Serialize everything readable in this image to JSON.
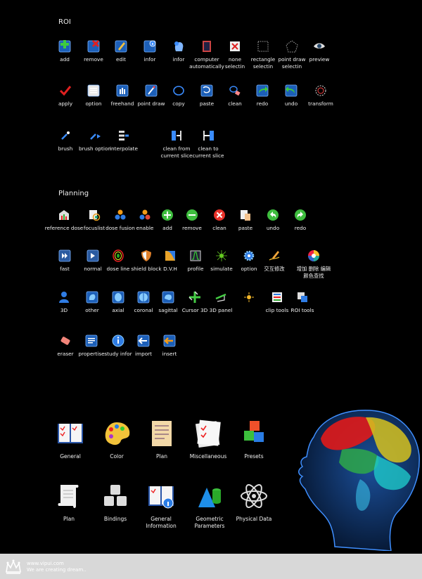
{
  "roi": {
    "title": "ROI",
    "row1": [
      {
        "label": "add",
        "icon": "add-roi-icon"
      },
      {
        "label": "remove",
        "icon": "remove-roi-icon"
      },
      {
        "label": "edit",
        "icon": "edit-roi-icon"
      },
      {
        "label": "infor",
        "icon": "info-roi-icon"
      },
      {
        "label": "infor",
        "icon": "head-info-icon"
      },
      {
        "label": "computer\nautomatically",
        "icon": "computer-auto-icon"
      },
      {
        "label": "none\nselectin",
        "icon": "none-selection-icon"
      },
      {
        "label": "rectangle\nselectin",
        "icon": "rectangle-selection-icon"
      },
      {
        "label": "point draw\nselectin",
        "icon": "point-draw-selection-icon"
      },
      {
        "label": "preview",
        "icon": "eye-preview-icon"
      }
    ],
    "row2": [
      {
        "label": "apply",
        "icon": "checkmark-icon"
      },
      {
        "label": "option",
        "icon": "option-list-icon"
      },
      {
        "label": "freehand",
        "icon": "freehand-icon"
      },
      {
        "label": "point draw",
        "icon": "point-draw-icon"
      },
      {
        "label": "copy",
        "icon": "copy-icon"
      },
      {
        "label": "paste",
        "icon": "paste-icon"
      },
      {
        "label": "clean",
        "icon": "clean-icon"
      },
      {
        "label": "redo",
        "icon": "redo-icon"
      },
      {
        "label": "undo",
        "icon": "undo-icon"
      },
      {
        "label": "transform",
        "icon": "transform-icon"
      }
    ],
    "row3": [
      {
        "label": "brush",
        "icon": "brush-icon"
      },
      {
        "label": "brush option",
        "icon": "brush-option-icon"
      },
      {
        "label": "interpolate",
        "icon": "interpolate-icon"
      },
      {
        "label": "clean from\ncurrent slice",
        "icon": "clean-from-slice-icon"
      },
      {
        "label": "clean to\ncurrent slice",
        "icon": "clean-to-slice-icon"
      }
    ]
  },
  "planning": {
    "title": "Planning",
    "row1": [
      {
        "label": "reference dose",
        "icon": "reference-dose-icon"
      },
      {
        "label": "focuslist",
        "icon": "focuslist-icon"
      },
      {
        "label": "dose fusion",
        "icon": "dose-fusion-icon"
      },
      {
        "label": "enable",
        "icon": "enable-icon"
      },
      {
        "label": "add",
        "icon": "add-circle-icon"
      },
      {
        "label": "remove",
        "icon": "remove-circle-icon"
      },
      {
        "label": "clean",
        "icon": "clean-circle-icon"
      },
      {
        "label": "paste",
        "icon": "paste-doc-icon"
      },
      {
        "label": "undo",
        "icon": "undo-circle-icon"
      },
      {
        "label": "redo",
        "icon": "redo-circle-icon"
      }
    ],
    "row2": [
      {
        "label": "fast",
        "icon": "fast-icon"
      },
      {
        "label": "normal",
        "icon": "normal-icon"
      },
      {
        "label": "dose line",
        "icon": "dose-line-icon"
      },
      {
        "label": "shield block",
        "icon": "shield-block-icon"
      },
      {
        "label": "D.V.H",
        "icon": "dvh-icon"
      },
      {
        "label": "profile",
        "icon": "profile-icon"
      },
      {
        "label": "simulate",
        "icon": "simulate-icon"
      },
      {
        "label": "option",
        "icon": "gear-option-icon"
      },
      {
        "label": "交互修改",
        "icon": "interactive-edit-icon"
      },
      {
        "label": "增加 删除 编辑\n颜色查找",
        "icon": "color-wheel-icon"
      }
    ],
    "row3": [
      {
        "label": "3D",
        "icon": "person-3d-icon"
      },
      {
        "label": "other",
        "icon": "other-view-icon"
      },
      {
        "label": "axial",
        "icon": "axial-icon"
      },
      {
        "label": "coronal",
        "icon": "coronal-icon"
      },
      {
        "label": "sagittal",
        "icon": "sagittal-icon"
      },
      {
        "label": "Cursor 3D",
        "icon": "cursor-3d-icon"
      },
      {
        "label": "3D panel",
        "icon": "panel-3d-icon"
      },
      {
        "label": "",
        "icon": "light-icon"
      },
      {
        "label": "clip tools",
        "icon": "clip-tools-icon"
      },
      {
        "label": "ROI tools",
        "icon": "roi-tools-icon"
      }
    ],
    "row4": [
      {
        "label": "eraser",
        "icon": "eraser-icon"
      },
      {
        "label": "propertise",
        "icon": "properties-icon"
      },
      {
        "label": "study infor",
        "icon": "study-info-icon"
      },
      {
        "label": "import",
        "icon": "import-icon"
      },
      {
        "label": "insert",
        "icon": "insert-icon"
      }
    ]
  },
  "large_icons": {
    "row1": [
      {
        "label": "General",
        "icon": "general-book-icon"
      },
      {
        "label": "Color",
        "icon": "color-palette-icon"
      },
      {
        "label": "Plan",
        "icon": "plan-notepad-icon"
      },
      {
        "label": "Miscellaneous",
        "icon": "miscellaneous-checklist-icon"
      },
      {
        "label": "Presets",
        "icon": "presets-cubes-icon"
      }
    ],
    "row2": [
      {
        "label": "Plan",
        "icon": "plan-scroll-icon"
      },
      {
        "label": "Bindings",
        "icon": "bindings-keys-icon"
      },
      {
        "label": "General\nInformation",
        "icon": "general-information-icon"
      },
      {
        "label": "Geometric\nParameters",
        "icon": "geometric-shapes-icon"
      },
      {
        "label": "Physical Data",
        "icon": "atom-icon"
      }
    ]
  },
  "footer": {
    "url": "www.vipui.com",
    "tagline": "We are creating dream.."
  }
}
